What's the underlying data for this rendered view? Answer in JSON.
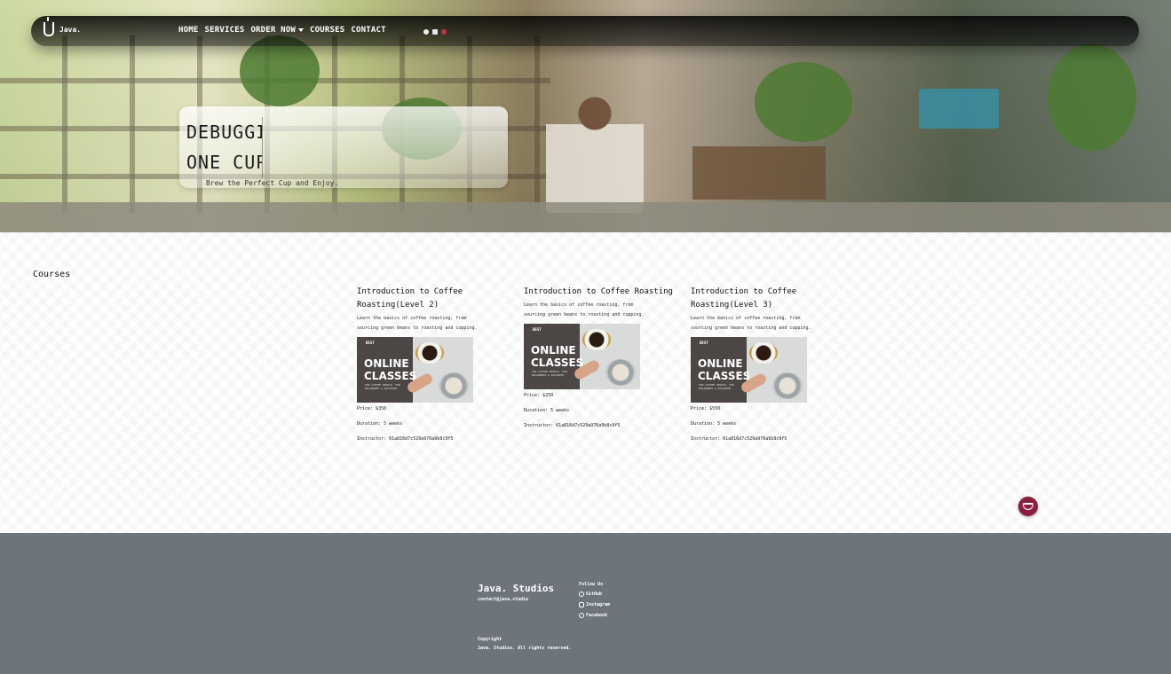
{
  "nav": {
    "brand": "Java.",
    "links": [
      "HOME",
      "SERVICES",
      "ORDER NOW",
      "COURSES",
      "CONTACT"
    ]
  },
  "hero": {
    "headline_line1": "DEBUGGIN",
    "headline_line2": "ONE CUP",
    "subline": "Brew the Perfect Cup and Enjoy."
  },
  "courses": {
    "title": "Courses",
    "items": [
      {
        "title": "Introduction to Coffee Roasting(Level 2)",
        "description": "Learn the basics of coffee roasting, from sourcing green beans to roasting and cupping.",
        "thumb_small": "BEST",
        "thumb_big": "ONLINE CLASSES",
        "thumb_note": "FOR COFFEE PEOPLE, FOR BEGINNERS & ADVANCED",
        "price": "Price: $350",
        "duration": "Duration: 5 weeks",
        "instructor": "Instructor: 61a816d7c529a976a9b8c9f5"
      },
      {
        "title": "Introduction to Coffee Roasting",
        "description": "Learn the basics of coffee roasting, from sourcing green beans to roasting and cupping.",
        "thumb_small": "BEST",
        "thumb_big": "ONLINE CLASSES",
        "thumb_note": "FOR COFFEE PEOPLE, FOR BEGINNERS & ADVANCED",
        "price": "Price: $250",
        "duration": "Duration: 5 weeks",
        "instructor": "Instructor: 61a816d7c529a976a9b8c9f5"
      },
      {
        "title": "Introduction to Coffee Roasting(Level 3)",
        "description": "Learn the basics of coffee roasting, from sourcing green beans to roasting and cupping.",
        "thumb_small": "BEST",
        "thumb_big": "ONLINE CLASSES",
        "thumb_note": "FOR COFFEE PEOPLE, FOR BEGINNERS & ADVANCED",
        "price": "Price: $550",
        "duration": "Duration: 5 weeks",
        "instructor": "Instructor: 61a816d7c529a976a9b8c9f5"
      }
    ]
  },
  "footer": {
    "brand": "Java. Studios",
    "email": "contact@java.studio",
    "follow_heading": "Follow Us",
    "social": [
      "GitHub",
      "Instagram",
      "Facebook"
    ],
    "copyright_heading": "Copyright",
    "copyright_text": "Java. Studios. All rights reserved."
  },
  "colors": {
    "accent": "#8b1e3f",
    "footer_bg": "#6d747c",
    "nav_bg": "#000000"
  }
}
